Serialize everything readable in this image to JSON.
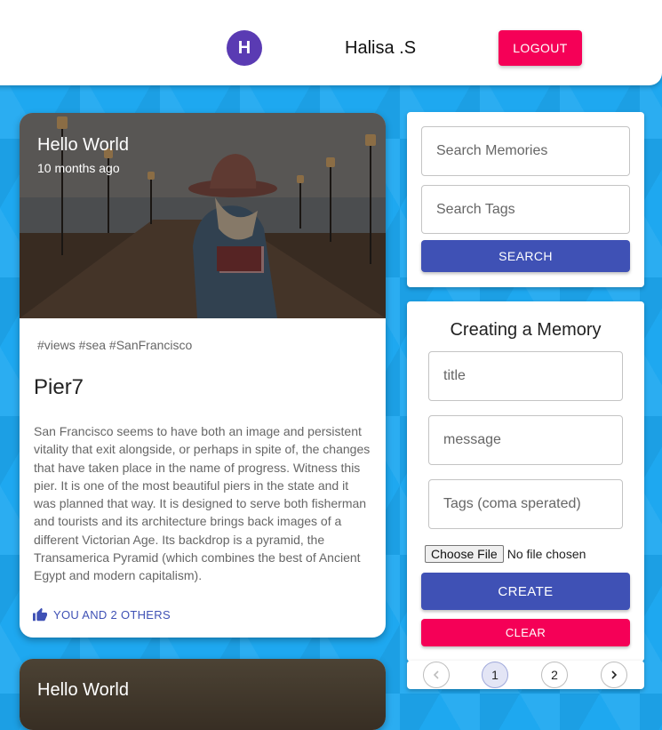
{
  "header": {
    "avatar_initial": "H",
    "username": "Halisa .S",
    "logout_label": "LOGOUT"
  },
  "posts": [
    {
      "title_overlay": "Hello World",
      "time": "10 months ago",
      "tags": "#views #sea #SanFrancisco",
      "title": "Pier7",
      "body": "San Francisco seems to have both an image and persistent vitality that exit alongside, or perhaps in spite of, the changes that have taken place in the name of progress. Witness this pier. It is one of the most beautiful piers in the state and it was planned that way. It is designed to serve both fisherman and tourists and its architecture brings back images of a different Victorian Age. Its backdrop is a pyramid, the Transamerica Pyramid (which combines the best of Ancient Egypt and modern capitalism).",
      "likes": "YOU AND 2 OTHERS"
    },
    {
      "title_overlay": "Hello World"
    }
  ],
  "search": {
    "memories_placeholder": "Search Memories",
    "tags_placeholder": "Search Tags",
    "button_label": "SEARCH"
  },
  "form": {
    "heading": "Creating a Memory",
    "title_placeholder": "title",
    "message_placeholder": "message",
    "tags_placeholder": "Tags (coma sperated)",
    "file_button": "Choose File",
    "file_status": "No file chosen",
    "create_label": "CREATE",
    "clear_label": "CLEAR"
  },
  "pagination": {
    "prev": "‹",
    "pages": [
      "1",
      "2"
    ],
    "next": "›",
    "active": "1"
  },
  "colors": {
    "primary": "#3f51b5",
    "secondary": "#f50057",
    "avatar": "#5a3bb3",
    "background": "#1ea8f0"
  }
}
